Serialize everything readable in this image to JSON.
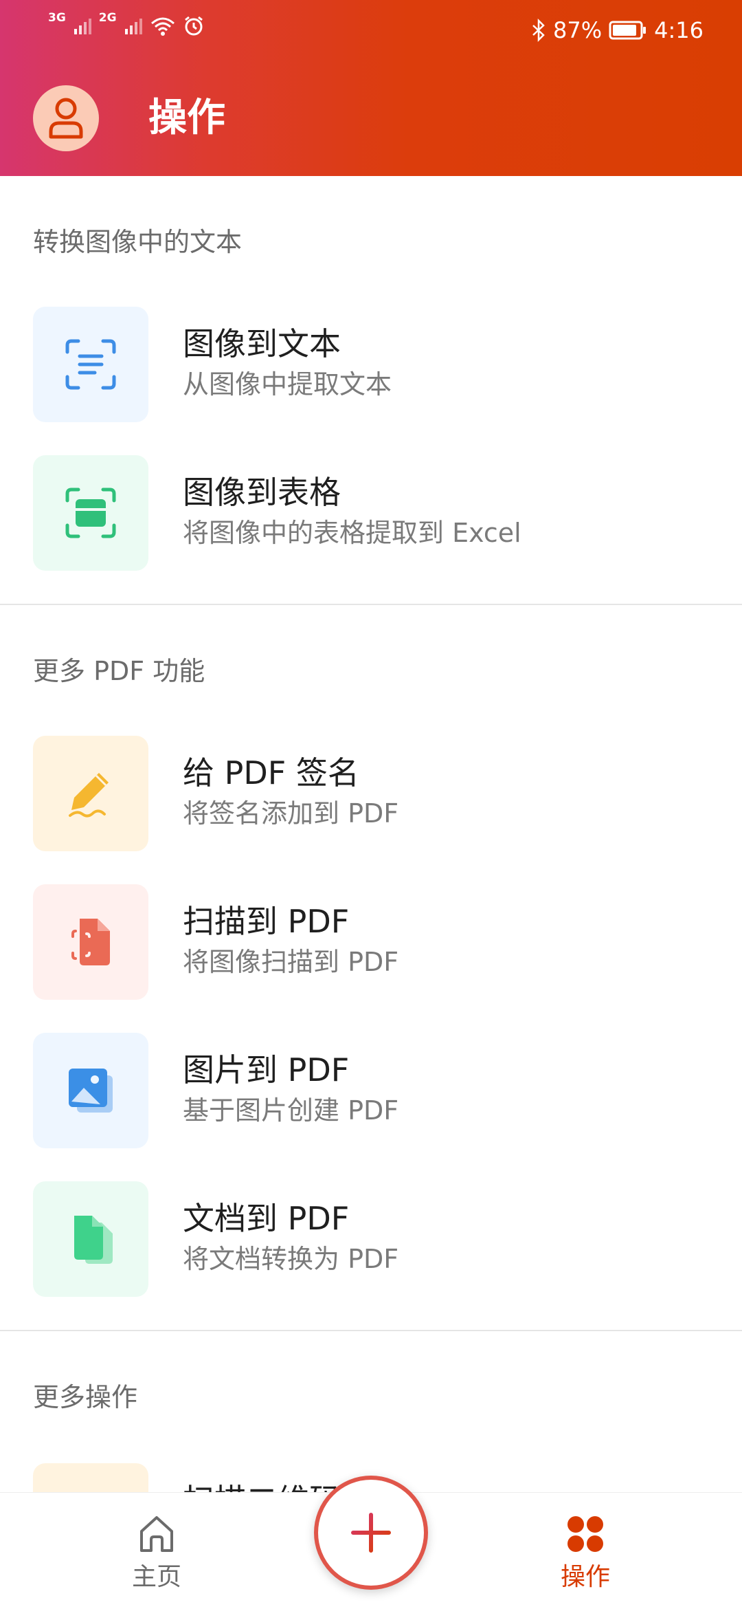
{
  "status_bar": {
    "network_1": "3G",
    "network_2": "2G",
    "battery": "87%",
    "time": "4:16"
  },
  "header": {
    "title": "操作"
  },
  "sections": [
    {
      "title": "转换图像中的文本",
      "items": [
        {
          "title": "图像到文本",
          "subtitle": "从图像中提取文本",
          "icon": "text-scan-icon",
          "color": "#3d8de6",
          "bg": "#eef6ff"
        },
        {
          "title": "图像到表格",
          "subtitle": "将图像中的表格提取到 Excel",
          "icon": "table-scan-icon",
          "color": "#2fc07a",
          "bg": "#ebfbf3"
        }
      ]
    },
    {
      "title": "更多 PDF 功能",
      "items": [
        {
          "title": "给 PDF 签名",
          "subtitle": "将签名添加到 PDF",
          "icon": "pen-sign-icon",
          "color": "#f5b730",
          "bg": "#fff3df"
        },
        {
          "title": "扫描到 PDF",
          "subtitle": "将图像扫描到 PDF",
          "icon": "scan-document-icon",
          "color": "#ea6a55",
          "bg": "#fff0ee"
        },
        {
          "title": "图片到 PDF",
          "subtitle": "基于图片创建 PDF",
          "icon": "picture-icon",
          "color": "#3b8fe6",
          "bg": "#eef6ff"
        },
        {
          "title": "文档到 PDF",
          "subtitle": "将文档转换为 PDF",
          "icon": "document-icon",
          "color": "#3fd28b",
          "bg": "#ebfbf3"
        }
      ]
    },
    {
      "title": "更多操作",
      "items": [
        {
          "title": "扫描二维码",
          "icon": "qr-scan-icon",
          "bg": "#fff3df"
        }
      ]
    }
  ],
  "bottom_nav": {
    "home_label": "主页",
    "actions_label": "操作",
    "active_color": "#d83b01",
    "inactive_color": "#6b6b6b"
  }
}
